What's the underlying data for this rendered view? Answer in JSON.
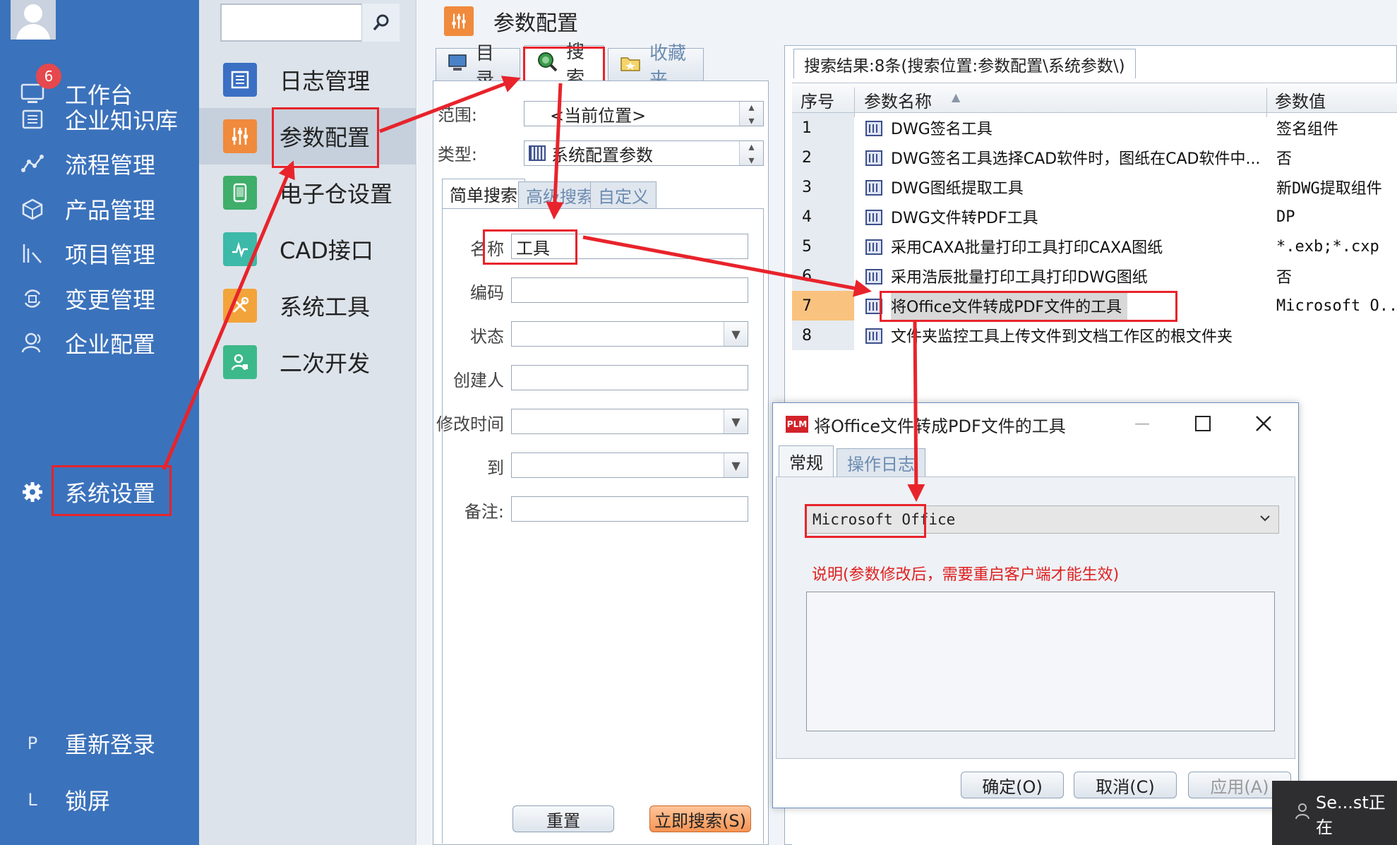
{
  "nav": {
    "badge": "6",
    "items": [
      {
        "label": "工作台",
        "icon": "monitor-icon"
      },
      {
        "label": "企业知识库",
        "icon": "book-icon"
      },
      {
        "label": "流程管理",
        "icon": "flow-icon"
      },
      {
        "label": "产品管理",
        "icon": "cube-icon"
      },
      {
        "label": "项目管理",
        "icon": "chart-icon"
      },
      {
        "label": "变更管理",
        "icon": "change-icon"
      },
      {
        "label": "企业配置",
        "icon": "user-icon"
      },
      {
        "label": "系统设置",
        "icon": "gear-icon"
      }
    ],
    "bottom": [
      {
        "key": "P",
        "label": "重新登录"
      },
      {
        "key": "L",
        "label": "锁屏"
      }
    ]
  },
  "subnav": {
    "search_value": "",
    "items": [
      {
        "label": "日志管理",
        "color": "#3a6fc4"
      },
      {
        "label": "参数配置",
        "color": "#f08a3c"
      },
      {
        "label": "电子仓设置",
        "color": "#3fae6a"
      },
      {
        "label": "CAD接口",
        "color": "#3cb9a8"
      },
      {
        "label": "系统工具",
        "color": "#f2a33a"
      },
      {
        "label": "二次开发",
        "color": "#3cb98a"
      }
    ]
  },
  "main": {
    "title": "参数配置",
    "tabs": [
      "目录",
      "搜索",
      "收藏夹"
    ],
    "search": {
      "scope_label": "范围:",
      "scope_value": "<当前位置>",
      "type_label": "类型:",
      "type_value": "系统配置参数",
      "subtabs": [
        "简单搜索",
        "高级搜索",
        "自定义"
      ],
      "fields": {
        "name_label": "名称",
        "name_value": "工具",
        "code_label": "编码",
        "status_label": "状态",
        "creator_label": "创建人",
        "modified_label": "修改时间",
        "to_label": "到",
        "remark_label": "备注:"
      },
      "reset_button": "重置",
      "search_button": "立即搜索(S)"
    },
    "results": {
      "tab_label": "搜索结果:8条(搜索位置:参数配置\\系统参数\\)",
      "columns": [
        "序号",
        "参数名称",
        "参数值"
      ],
      "rows": [
        {
          "no": "1",
          "name": "DWG签名工具",
          "value": "签名组件"
        },
        {
          "no": "2",
          "name": "DWG签名工具选择CAD软件时，图纸在CAD软件中...",
          "value": "否"
        },
        {
          "no": "3",
          "name": "DWG图纸提取工具",
          "value": "新DWG提取组件"
        },
        {
          "no": "4",
          "name": "DWG文件转PDF工具",
          "value": "DP"
        },
        {
          "no": "5",
          "name": "采用CAXA批量打印工具打印CAXA图纸",
          "value": "*.exb;*.cxp"
        },
        {
          "no": "6",
          "name": "采用浩辰批量打印工具打印DWG图纸",
          "value": "否"
        },
        {
          "no": "7",
          "name": "将Office文件转成PDF文件的工具",
          "value": "Microsoft O..."
        },
        {
          "no": "8",
          "name": "文件夹监控工具上传文件到文档工作区的根文件夹",
          "value": ""
        }
      ],
      "selected_row": 7
    }
  },
  "dialog": {
    "logo": "PLM",
    "title": "将Office文件转成PDF文件的工具",
    "tabs": [
      "常规",
      "操作日志"
    ],
    "select_value": "Microsoft Office",
    "note": "说明(参数修改后，需要重启客户端才能生效)",
    "ok_button": "确定(O)",
    "cancel_button": "取消(C)",
    "apply_button": "应用(A)"
  },
  "toast": {
    "text": "Se...st正在"
  },
  "colors": {
    "nav_bg": "#3b72bc",
    "highlight": "#e8232b",
    "selected_row": "#f9c27f"
  }
}
